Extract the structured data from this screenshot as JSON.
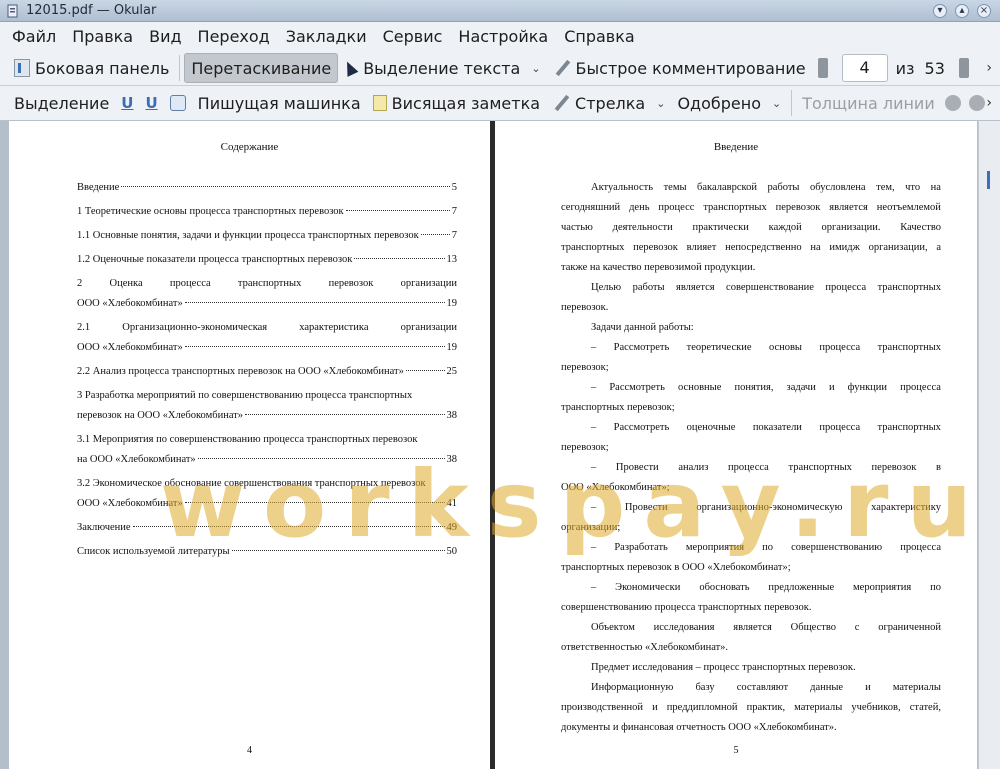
{
  "window": {
    "title": "12015.pdf — Okular"
  },
  "menu": [
    "Файл",
    "Правка",
    "Вид",
    "Переход",
    "Закладки",
    "Сервис",
    "Настройка",
    "Справка"
  ],
  "toolbar1": {
    "sidebar": "Боковая панель",
    "drag": "Перетаскивание",
    "text_select": "Выделение текста",
    "quick_comment": "Быстрое комментирование",
    "page_current": "4",
    "page_of": "из",
    "page_total": "53"
  },
  "toolbar2": {
    "highlight": "Выделение",
    "typewriter": "Пишущая машинка",
    "popup_note": "Висящая заметка",
    "arrow": "Стрелка",
    "approved": "Одобрено",
    "line_width": "Толщина линии"
  },
  "left_page": {
    "title": "Содержание",
    "toc": [
      {
        "t": "Введение",
        "p": "5"
      },
      {
        "t": "1 Теоретические основы процесса транспортных перевозок",
        "p": "7"
      },
      {
        "t": "1.1 Основные понятия, задачи и функции процесса транспортных перевозок",
        "p": "7"
      },
      {
        "t": "1.2 Оценочные показатели процесса транспортных перевозок",
        "p": "13"
      },
      {
        "l1": [
          "2",
          "Оценка",
          "процесса",
          "транспортных",
          "перевозок",
          "организации"
        ],
        "t": "ООО «Хлебокомбинат»",
        "p": "19"
      },
      {
        "l1": [
          "2.1",
          "Организационно-экономическая",
          "характеристика",
          "организации"
        ],
        "t": "ООО «Хлебокомбинат»",
        "p": "19"
      },
      {
        "t": "2.2 Анализ процесса транспортных перевозок на ООО «Хлебокомбинат»",
        "p": "25"
      },
      {
        "l1": [
          "3 Разработка мероприятий по совершенствованию процесса транспортных"
        ],
        "t": "перевозок на ООО «Хлебокомбинат»",
        "p": "38"
      },
      {
        "l1": [
          "3.1 Мероприятия по совершенствованию процесса транспортных перевозок"
        ],
        "t": "на ООО «Хлебокомбинат»",
        "p": "38"
      },
      {
        "l1": [
          "3.2 Экономическое обоснование совершенствования транспортных перевозок"
        ],
        "t": "ООО «Хлебокомбинат»",
        "p": "41"
      },
      {
        "t": "Заключение",
        "p": "49"
      },
      {
        "t": "Список используемой литературы",
        "p": "50"
      }
    ],
    "page_number": "4"
  },
  "right_page": {
    "title": "Введение",
    "lines": [
      {
        "text": "Актуальность темы бакалаврской работы обусловлена тем, что на",
        "ind": true
      },
      {
        "text": "сегодняшний день процесс транспортных перевозок является неотъемлемой"
      },
      {
        "text": "частью деятельности практически каждой организации. Качество"
      },
      {
        "text": "транспортных перевозок влияет непосредственно на имидж организации, а"
      },
      {
        "text": "также на качество перевозимой продукции.",
        "last": true
      },
      {
        "text": "Целью работы является совершенствование процесса транспортных",
        "ind": true
      },
      {
        "text": "перевозок.",
        "last": true
      },
      {
        "text": "Задачи данной работы:",
        "ind": true,
        "last": true
      },
      {
        "text": "– Рассмотреть теоретические основы процесса транспортных",
        "ind": true
      },
      {
        "text": "перевозок;",
        "last": true
      },
      {
        "text": "– Рассмотреть основные понятия, задачи и функции процесса",
        "ind": true
      },
      {
        "text": "транспортных перевозок;",
        "last": true
      },
      {
        "text": "– Рассмотреть оценочные показатели процесса транспортных",
        "ind": true
      },
      {
        "text": "перевозок;",
        "last": true
      },
      {
        "text": "– Провести анализ процесса транспортных перевозок в",
        "ind": true
      },
      {
        "text": "ООО «Хлебокомбинат»;",
        "last": true
      },
      {
        "text": "– Провести организационно-экономическую характеристику",
        "ind": true
      },
      {
        "text": "организации;",
        "last": true
      },
      {
        "text": "– Разработать мероприятия по совершенствованию процесса",
        "ind": true
      },
      {
        "text": "транспортных перевозок в ООО «Хлебокомбинат»;",
        "last": true
      },
      {
        "text": "– Экономически обосновать предложенные мероприятия по",
        "ind": true
      },
      {
        "text": "совершенствованию процесса транспортных перевозок.",
        "last": true
      },
      {
        "text": "Объектом исследования является Общество с ограниченной",
        "ind": true
      },
      {
        "text": "ответственностью «Хлебокомбинат».",
        "last": true
      },
      {
        "text": "Предмет исследования – процесс транспортных перевозок.",
        "ind": true,
        "last": true
      },
      {
        "text": "Информационную базу составляют данные и материалы",
        "ind": true
      },
      {
        "text": "производственной и преддипломной практик, материалы учебников, статей,"
      },
      {
        "text": "документы и финансовая отчетность ООО «Хлебокомбинат».",
        "last": true
      }
    ],
    "page_number": "5"
  },
  "watermark": "workspay.ru"
}
